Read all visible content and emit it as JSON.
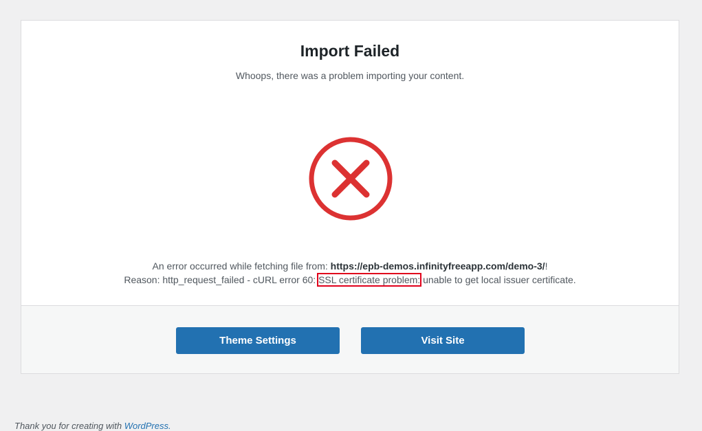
{
  "dialog": {
    "title": "Import Failed",
    "subtitle": "Whoops, there was a problem importing your content.",
    "icon": "error-x-circle-icon",
    "error_color": "#dc3232",
    "message": {
      "line1_prefix": "An error occurred while fetching file from: ",
      "url": "https://epb-demos.infinityfreeapp.com/demo-3/",
      "line1_suffix": "!",
      "line2_prefix": "Reason: http_request_failed - cURL error 60: ",
      "line2_highlight": "SSL certificate problem:",
      "line2_suffix": " unable to get local issuer certificate."
    }
  },
  "buttons": {
    "theme_settings": "Theme Settings",
    "visit_site": "Visit Site",
    "color": "#2271b1"
  },
  "footer": {
    "text": "Thank you for creating with ",
    "link": "WordPress."
  }
}
